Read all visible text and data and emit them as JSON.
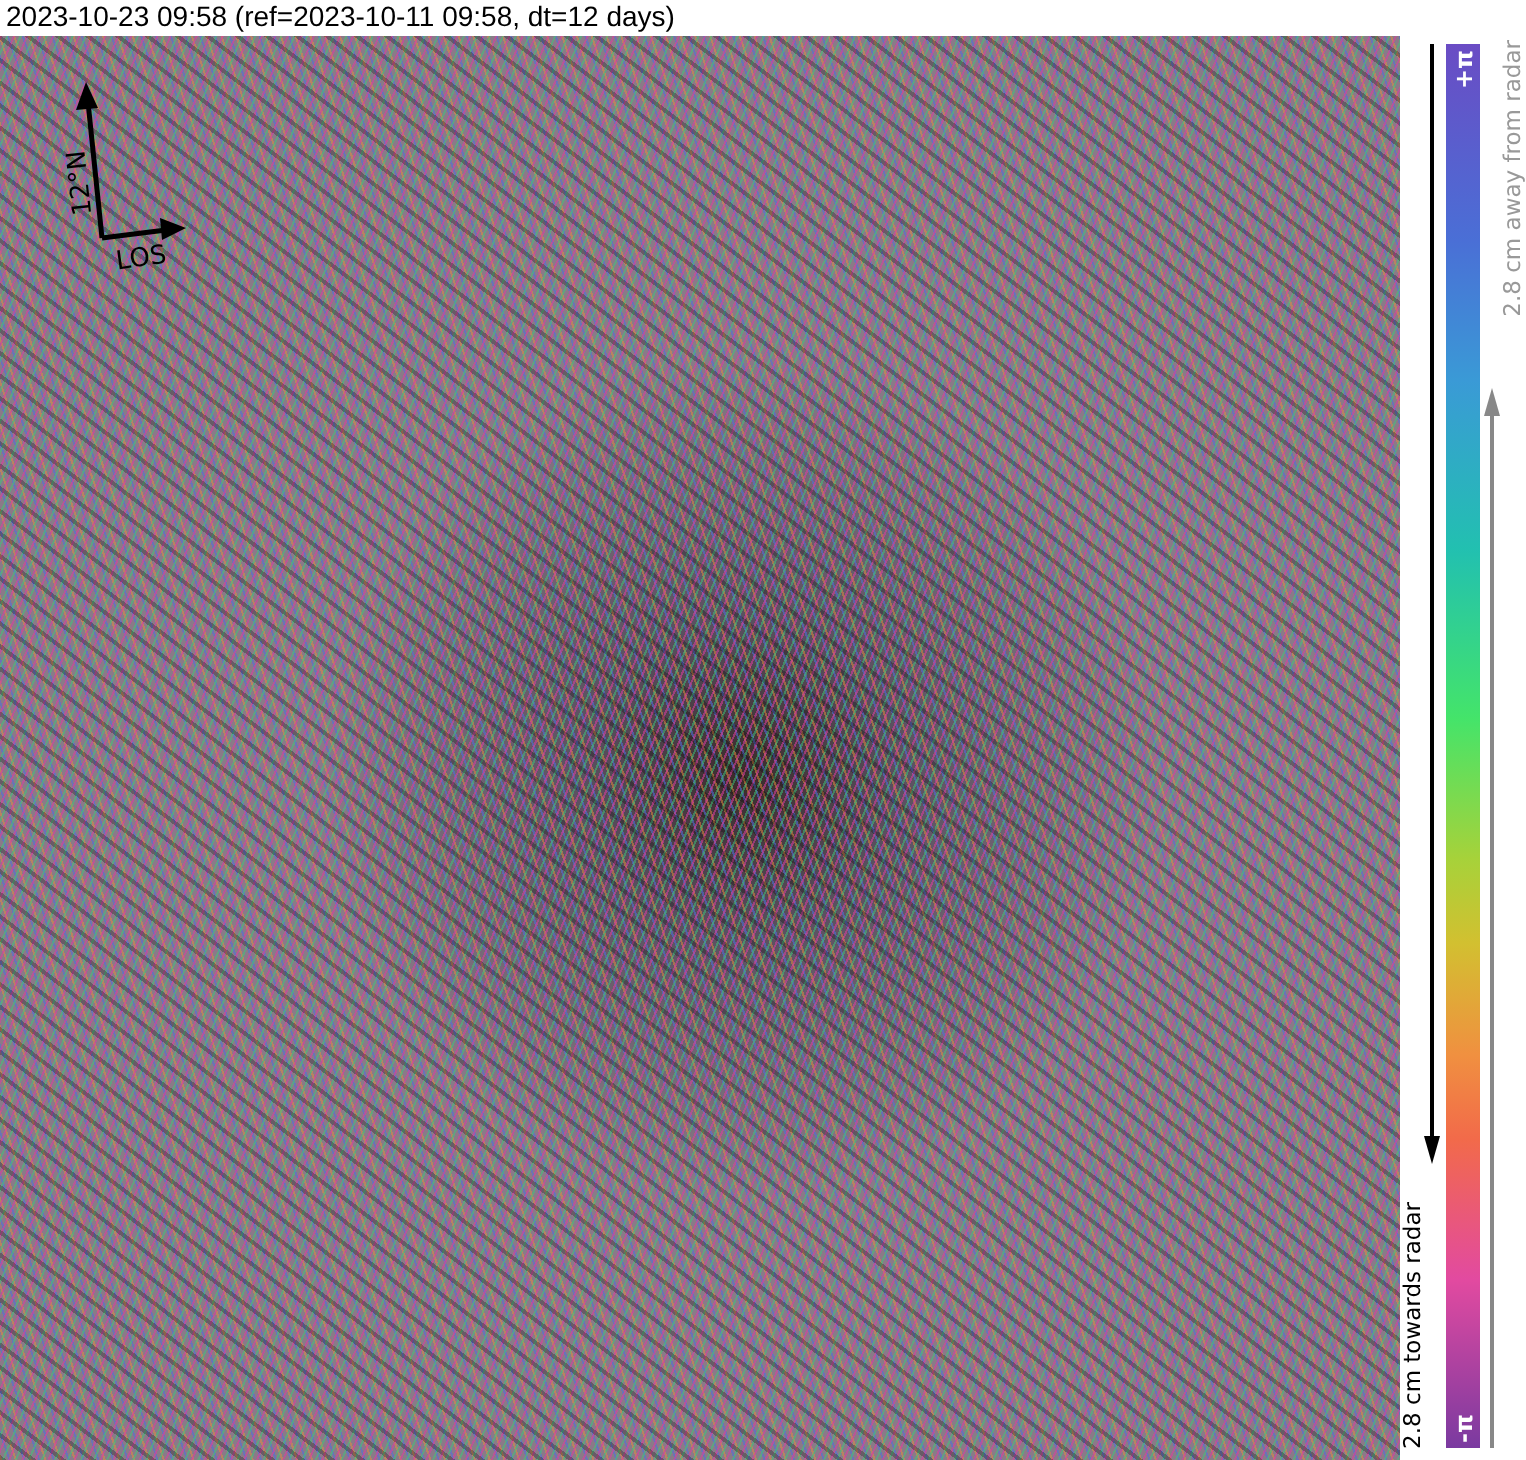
{
  "title": "2023-10-23 09:58 (ref=2023-10-11 09:58, dt=12 days)",
  "compass": {
    "north_label": "12°N",
    "los_label": "LOS"
  },
  "colorbar": {
    "top_label": "+π",
    "bottom_label": "-π",
    "towards_label": "2.8 cm towards radar",
    "away_label": "2.8 cm away from radar"
  }
}
